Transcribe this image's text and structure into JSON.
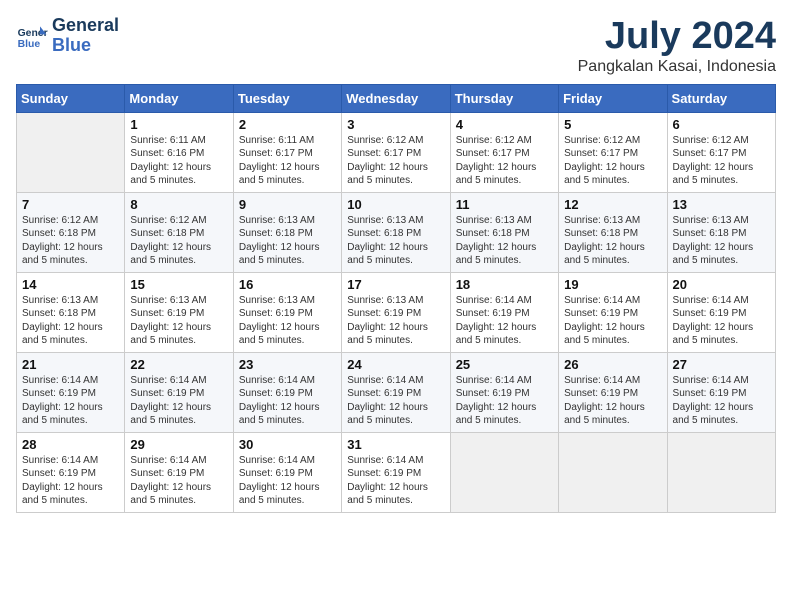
{
  "header": {
    "logo_line1": "General",
    "logo_line2": "Blue",
    "month": "July 2024",
    "location": "Pangkalan Kasai, Indonesia"
  },
  "weekdays": [
    "Sunday",
    "Monday",
    "Tuesday",
    "Wednesday",
    "Thursday",
    "Friday",
    "Saturday"
  ],
  "weeks": [
    [
      {
        "day": "",
        "sunrise": "",
        "sunset": "",
        "daylight": ""
      },
      {
        "day": "1",
        "sunrise": "Sunrise: 6:11 AM",
        "sunset": "Sunset: 6:16 PM",
        "daylight": "Daylight: 12 hours and 5 minutes."
      },
      {
        "day": "2",
        "sunrise": "Sunrise: 6:11 AM",
        "sunset": "Sunset: 6:17 PM",
        "daylight": "Daylight: 12 hours and 5 minutes."
      },
      {
        "day": "3",
        "sunrise": "Sunrise: 6:12 AM",
        "sunset": "Sunset: 6:17 PM",
        "daylight": "Daylight: 12 hours and 5 minutes."
      },
      {
        "day": "4",
        "sunrise": "Sunrise: 6:12 AM",
        "sunset": "Sunset: 6:17 PM",
        "daylight": "Daylight: 12 hours and 5 minutes."
      },
      {
        "day": "5",
        "sunrise": "Sunrise: 6:12 AM",
        "sunset": "Sunset: 6:17 PM",
        "daylight": "Daylight: 12 hours and 5 minutes."
      },
      {
        "day": "6",
        "sunrise": "Sunrise: 6:12 AM",
        "sunset": "Sunset: 6:17 PM",
        "daylight": "Daylight: 12 hours and 5 minutes."
      }
    ],
    [
      {
        "day": "7",
        "sunrise": "Sunrise: 6:12 AM",
        "sunset": "Sunset: 6:18 PM",
        "daylight": "Daylight: 12 hours and 5 minutes."
      },
      {
        "day": "8",
        "sunrise": "Sunrise: 6:12 AM",
        "sunset": "Sunset: 6:18 PM",
        "daylight": "Daylight: 12 hours and 5 minutes."
      },
      {
        "day": "9",
        "sunrise": "Sunrise: 6:13 AM",
        "sunset": "Sunset: 6:18 PM",
        "daylight": "Daylight: 12 hours and 5 minutes."
      },
      {
        "day": "10",
        "sunrise": "Sunrise: 6:13 AM",
        "sunset": "Sunset: 6:18 PM",
        "daylight": "Daylight: 12 hours and 5 minutes."
      },
      {
        "day": "11",
        "sunrise": "Sunrise: 6:13 AM",
        "sunset": "Sunset: 6:18 PM",
        "daylight": "Daylight: 12 hours and 5 minutes."
      },
      {
        "day": "12",
        "sunrise": "Sunrise: 6:13 AM",
        "sunset": "Sunset: 6:18 PM",
        "daylight": "Daylight: 12 hours and 5 minutes."
      },
      {
        "day": "13",
        "sunrise": "Sunrise: 6:13 AM",
        "sunset": "Sunset: 6:18 PM",
        "daylight": "Daylight: 12 hours and 5 minutes."
      }
    ],
    [
      {
        "day": "14",
        "sunrise": "Sunrise: 6:13 AM",
        "sunset": "Sunset: 6:18 PM",
        "daylight": "Daylight: 12 hours and 5 minutes."
      },
      {
        "day": "15",
        "sunrise": "Sunrise: 6:13 AM",
        "sunset": "Sunset: 6:19 PM",
        "daylight": "Daylight: 12 hours and 5 minutes."
      },
      {
        "day": "16",
        "sunrise": "Sunrise: 6:13 AM",
        "sunset": "Sunset: 6:19 PM",
        "daylight": "Daylight: 12 hours and 5 minutes."
      },
      {
        "day": "17",
        "sunrise": "Sunrise: 6:13 AM",
        "sunset": "Sunset: 6:19 PM",
        "daylight": "Daylight: 12 hours and 5 minutes."
      },
      {
        "day": "18",
        "sunrise": "Sunrise: 6:14 AM",
        "sunset": "Sunset: 6:19 PM",
        "daylight": "Daylight: 12 hours and 5 minutes."
      },
      {
        "day": "19",
        "sunrise": "Sunrise: 6:14 AM",
        "sunset": "Sunset: 6:19 PM",
        "daylight": "Daylight: 12 hours and 5 minutes."
      },
      {
        "day": "20",
        "sunrise": "Sunrise: 6:14 AM",
        "sunset": "Sunset: 6:19 PM",
        "daylight": "Daylight: 12 hours and 5 minutes."
      }
    ],
    [
      {
        "day": "21",
        "sunrise": "Sunrise: 6:14 AM",
        "sunset": "Sunset: 6:19 PM",
        "daylight": "Daylight: 12 hours and 5 minutes."
      },
      {
        "day": "22",
        "sunrise": "Sunrise: 6:14 AM",
        "sunset": "Sunset: 6:19 PM",
        "daylight": "Daylight: 12 hours and 5 minutes."
      },
      {
        "day": "23",
        "sunrise": "Sunrise: 6:14 AM",
        "sunset": "Sunset: 6:19 PM",
        "daylight": "Daylight: 12 hours and 5 minutes."
      },
      {
        "day": "24",
        "sunrise": "Sunrise: 6:14 AM",
        "sunset": "Sunset: 6:19 PM",
        "daylight": "Daylight: 12 hours and 5 minutes."
      },
      {
        "day": "25",
        "sunrise": "Sunrise: 6:14 AM",
        "sunset": "Sunset: 6:19 PM",
        "daylight": "Daylight: 12 hours and 5 minutes."
      },
      {
        "day": "26",
        "sunrise": "Sunrise: 6:14 AM",
        "sunset": "Sunset: 6:19 PM",
        "daylight": "Daylight: 12 hours and 5 minutes."
      },
      {
        "day": "27",
        "sunrise": "Sunrise: 6:14 AM",
        "sunset": "Sunset: 6:19 PM",
        "daylight": "Daylight: 12 hours and 5 minutes."
      }
    ],
    [
      {
        "day": "28",
        "sunrise": "Sunrise: 6:14 AM",
        "sunset": "Sunset: 6:19 PM",
        "daylight": "Daylight: 12 hours and 5 minutes."
      },
      {
        "day": "29",
        "sunrise": "Sunrise: 6:14 AM",
        "sunset": "Sunset: 6:19 PM",
        "daylight": "Daylight: 12 hours and 5 minutes."
      },
      {
        "day": "30",
        "sunrise": "Sunrise: 6:14 AM",
        "sunset": "Sunset: 6:19 PM",
        "daylight": "Daylight: 12 hours and 5 minutes."
      },
      {
        "day": "31",
        "sunrise": "Sunrise: 6:14 AM",
        "sunset": "Sunset: 6:19 PM",
        "daylight": "Daylight: 12 hours and 5 minutes."
      },
      {
        "day": "",
        "sunrise": "",
        "sunset": "",
        "daylight": ""
      },
      {
        "day": "",
        "sunrise": "",
        "sunset": "",
        "daylight": ""
      },
      {
        "day": "",
        "sunrise": "",
        "sunset": "",
        "daylight": ""
      }
    ]
  ]
}
